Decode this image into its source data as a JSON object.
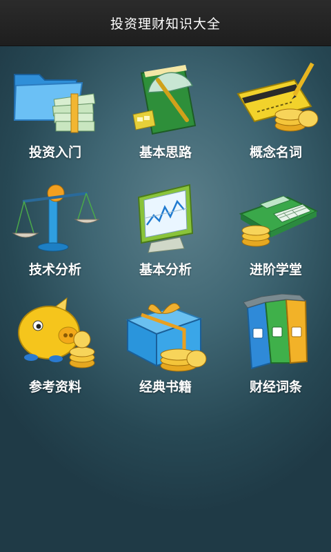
{
  "header": {
    "title": "投资理财知识大全"
  },
  "menu": {
    "items": [
      {
        "label": "投资入门",
        "icon": "folder-money-icon"
      },
      {
        "label": "基本思路",
        "icon": "book-protractor-icon"
      },
      {
        "label": "概念名词",
        "icon": "card-coins-icon"
      },
      {
        "label": "技术分析",
        "icon": "balance-scale-icon"
      },
      {
        "label": "基本分析",
        "icon": "chart-monitor-icon"
      },
      {
        "label": "进阶学堂",
        "icon": "calculator-coins-icon"
      },
      {
        "label": "参考资料",
        "icon": "piggy-bank-icon"
      },
      {
        "label": "经典书籍",
        "icon": "gift-coins-icon"
      },
      {
        "label": "财经词条",
        "icon": "binders-icon"
      }
    ]
  },
  "colors": {
    "titlebar": "#222222",
    "label": "#ffffff",
    "background": "#3f6673"
  }
}
